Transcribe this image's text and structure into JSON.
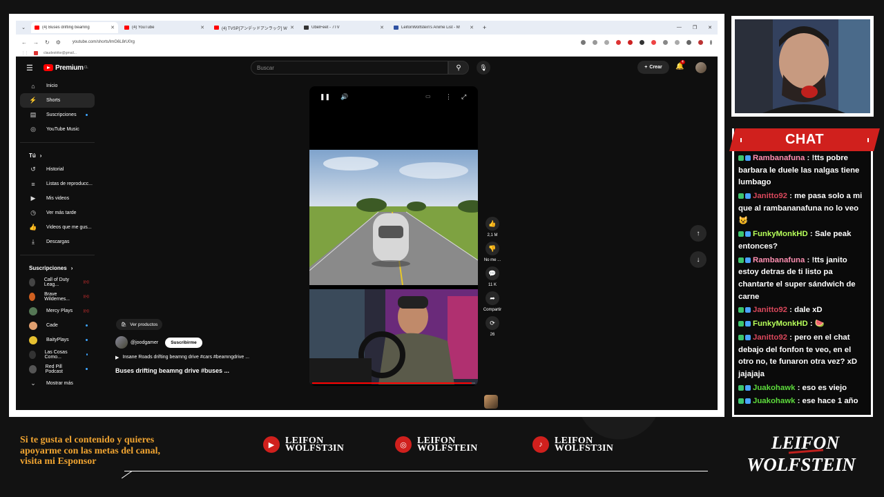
{
  "browser": {
    "tabs": [
      {
        "title": "(4) Buses drifting beamng",
        "color": "#ff0000",
        "active": true
      },
      {
        "title": "(4) YouTube",
        "color": "#ff0000",
        "active": false
      },
      {
        "title": "(4) TVSP[アンデッドアンラック] Wi...",
        "color": "#ff0000",
        "active": false
      },
      {
        "title": "UbelFeet - 7TV",
        "color": "#333333",
        "active": false
      },
      {
        "title": "LeifonWolfstein's Anime List - M",
        "color": "#2e51a2",
        "active": false
      }
    ],
    "url": "youtube.com/shorts/lmG6L8rU0rg",
    "bookmark": "claudestrike@gmail..."
  },
  "youtube": {
    "logo_text": "Premium",
    "logo_sup": "CL",
    "search_placeholder": "Buscar",
    "create_label": "Crear",
    "notif_count": "4",
    "sidebar_main": [
      {
        "label": "Inicio",
        "icon": "home-icon",
        "glyph": "⌂",
        "active": false,
        "dot": false
      },
      {
        "label": "Shorts",
        "icon": "shorts-icon",
        "glyph": "⚡",
        "active": true,
        "dot": false
      },
      {
        "label": "Suscripciones",
        "icon": "subscriptions-icon",
        "glyph": "▤",
        "active": false,
        "dot": true
      },
      {
        "label": "YouTube Music",
        "icon": "music-icon",
        "glyph": "◎",
        "active": false,
        "dot": false
      }
    ],
    "you_heading": "Tú",
    "sidebar_you": [
      {
        "label": "Historial",
        "icon": "history-icon",
        "glyph": "↺"
      },
      {
        "label": "Listas de reproducc...",
        "icon": "playlists-icon",
        "glyph": "≡"
      },
      {
        "label": "Mis videos",
        "icon": "my-videos-icon",
        "glyph": "▶"
      },
      {
        "label": "Ver más tarde",
        "icon": "watch-later-icon",
        "glyph": "◷"
      },
      {
        "label": "Videos que me gus...",
        "icon": "liked-icon",
        "glyph": "👍"
      },
      {
        "label": "Descargas",
        "icon": "download-icon",
        "glyph": "⤓"
      }
    ],
    "subs_heading": "Suscripciones",
    "subscriptions": [
      {
        "label": "Call of Duty Leag...",
        "color": "#444",
        "live": true
      },
      {
        "label": "Brave Wildernes...",
        "color": "#d06020",
        "live": true
      },
      {
        "label": "Mercy Plays",
        "color": "#557755",
        "live": true
      },
      {
        "label": "Cade",
        "color": "#e0a070",
        "live": false
      },
      {
        "label": "BaityPlays",
        "color": "#e6c030",
        "live": false
      },
      {
        "label": "Las Cosas Como...",
        "color": "#333",
        "live": false
      },
      {
        "label": "Red Pill Podcast",
        "color": "#555",
        "live": false
      }
    ],
    "show_more": "Mostrar más",
    "short": {
      "products_label": "Ver productos",
      "channel": "@joodgamer",
      "subscribe_label": "Suscribirme",
      "song": "Insane Roads drifting beamng drive #cars #beamngdrive ...",
      "title": "Buses drifting beamng drive #buses ...",
      "progress": 0.98
    },
    "actions": [
      {
        "icon": "like-icon",
        "glyph": "👍",
        "label": "2,1 M"
      },
      {
        "icon": "dislike-icon",
        "glyph": "👎",
        "label": "No me ..."
      },
      {
        "icon": "comment-icon",
        "glyph": "💬",
        "label": "11 K"
      },
      {
        "icon": "share-icon",
        "glyph": "➦",
        "label": "Compartir"
      },
      {
        "icon": "remix-icon",
        "glyph": "⟳",
        "label": "26"
      }
    ]
  },
  "chat": {
    "title": "CHAT",
    "messages": [
      {
        "user": "Rambanafuna",
        "color": "#ff8fb1",
        "text": "!tts pobre barbara le duele las nalgas tiene lumbago"
      },
      {
        "user": "Janitto92",
        "color": "#d9475b",
        "text": "me pasa solo a mi que al rambananafuna no lo veo 😺"
      },
      {
        "user": "FunkyMonkHD",
        "color": "#b6ff5a",
        "text": "Sale peak entonces?"
      },
      {
        "user": "Rambanafuna",
        "color": "#ff8fb1",
        "text": "!tts janito estoy detras de ti listo pa chantarte el super sándwich de carne"
      },
      {
        "user": "Janitto92",
        "color": "#d9475b",
        "text": "dale xD"
      },
      {
        "user": "FunkyMonkHD",
        "color": "#b6ff5a",
        "text": "🍉"
      },
      {
        "user": "Janitto92",
        "color": "#d9475b",
        "text": "pero en el chat debajo del fonfon te veo, en el otro no, te funaron otra vez? xD jajajaja"
      },
      {
        "user": "Juakohawk",
        "color": "#5ddb3c",
        "text": "eso es viejo"
      },
      {
        "user": "Juakohawk",
        "color": "#5ddb3c",
        "text": "ese hace 1 año"
      }
    ]
  },
  "footer": {
    "support_lines": [
      "Si te gusta el contenido y quieres",
      "apoyarme con las metas del canal,",
      "visita mi Esponsor"
    ],
    "socials": [
      {
        "icon": "youtube-icon",
        "glyph": "▶",
        "line1": "LEIFON",
        "line2": "WOLFST3IN"
      },
      {
        "icon": "instagram-icon",
        "glyph": "◎",
        "line1": "LEIFON",
        "line2": "WOLFSTEIN"
      },
      {
        "icon": "tiktok-icon",
        "glyph": "♪",
        "line1": "LEIFON",
        "line2": "WOLFST3IN"
      }
    ],
    "brand_line1": "LEIFON",
    "brand_line2": "WOLFSTEIN"
  }
}
